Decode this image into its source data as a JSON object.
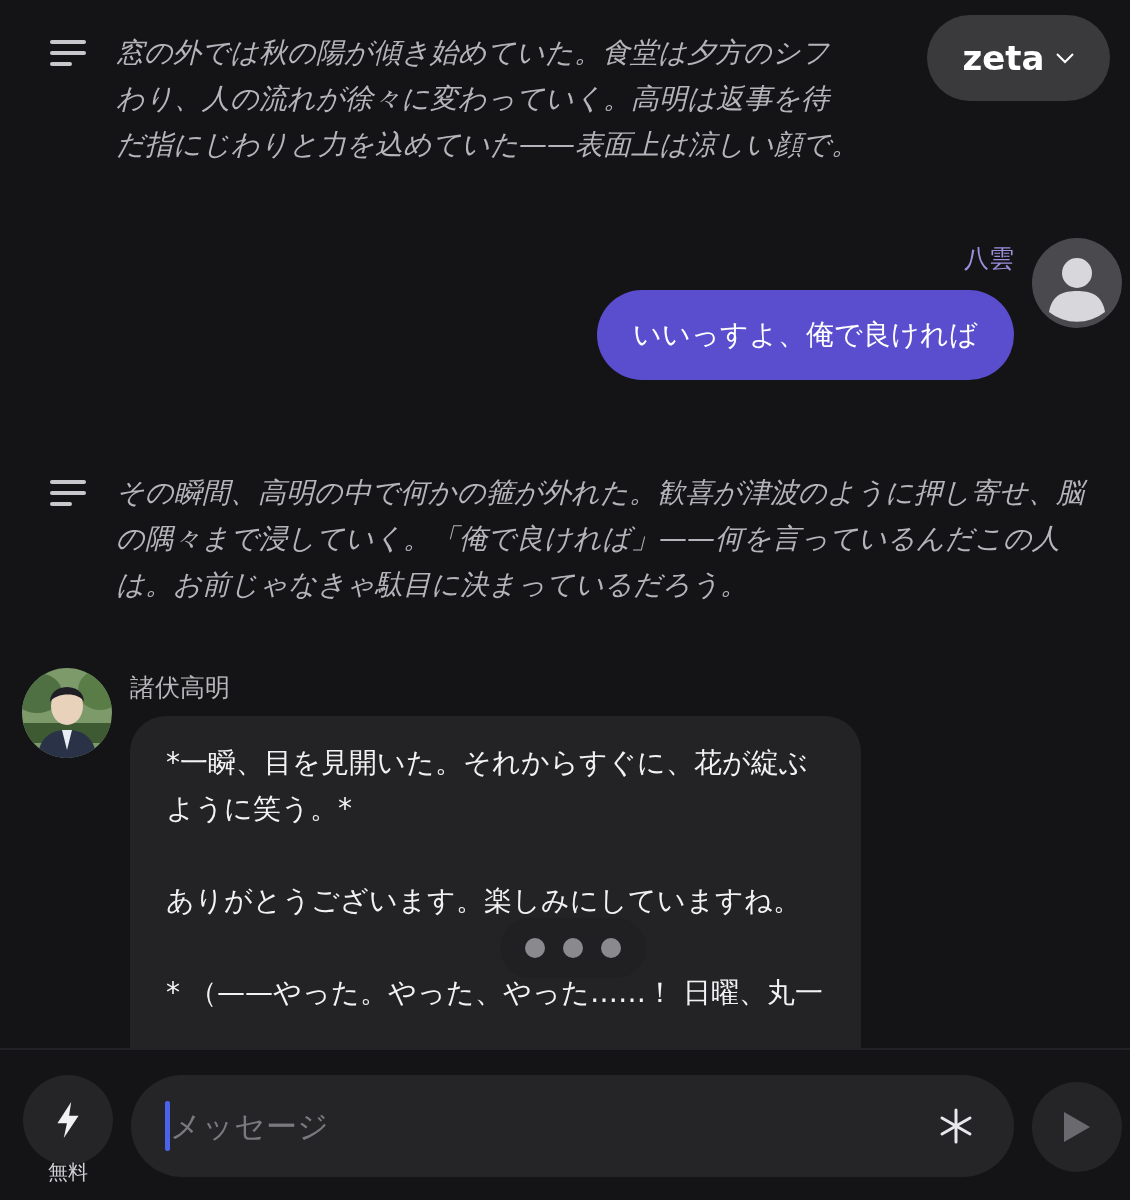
{
  "model_button": {
    "label": "zeta"
  },
  "messages": [
    {
      "kind": "narration",
      "lines": [
        "窓の外では秋の陽が傾き始めていた。食堂は夕方のシフ",
        "わり、人の流れが徐々に変わっていく。高明は返事を待",
        "だ指にじわりと力を込めていた——表面上は涼しい顔で。"
      ]
    },
    {
      "kind": "user",
      "name": "八雲",
      "text": "いいっすよ、俺で良ければ"
    },
    {
      "kind": "narration",
      "lines": [
        "その瞬間、高明の中で何かの箍が外れた。歓喜が津波のように押し寄せ、脳の隅々まで浸していく。「俺で良ければ」——何を言っているんだこの人は。お前じゃなきゃ駄目に決まっているだろう。"
      ]
    },
    {
      "kind": "character",
      "name": "諸伏高明",
      "avatar": {
        "kind": "picture"
      },
      "paragraphs": [
        "*一瞬、目を見開いた。それからすぐに、花が綻ぶように笑う。*",
        "ありがとうございます。楽しみにしていますね。",
        "* （——やった。やった、やった……！ 日曜、丸一"
      ]
    }
  ],
  "composer": {
    "boost_label": "無料",
    "placeholder": "メッセージ"
  }
}
